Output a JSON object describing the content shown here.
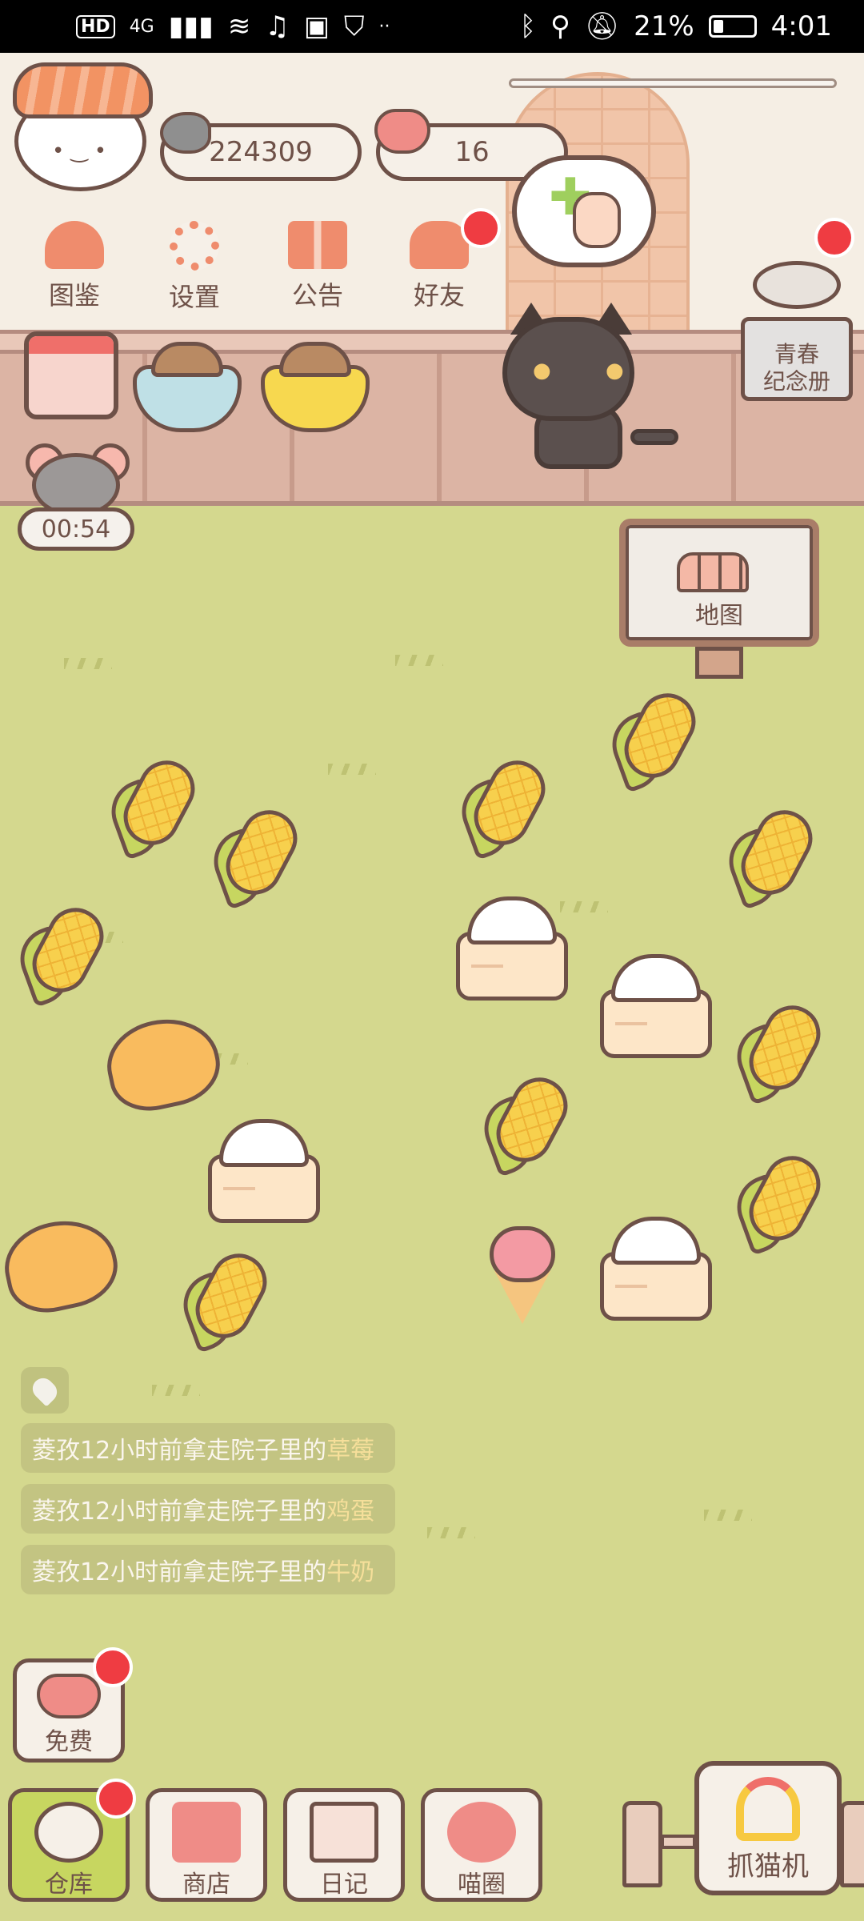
{
  "status_bar": {
    "network_badge": "HD",
    "network_type": "4G",
    "dots": "··",
    "battery": "21%",
    "time": "4:01"
  },
  "currency": {
    "fish": "224309",
    "hearts": "16"
  },
  "menu": {
    "book": "图鉴",
    "settings": "设置",
    "notice": "公告",
    "friends": "好友"
  },
  "yearbook": {
    "line1": "青春",
    "line2": "纪念册"
  },
  "timer": "00:54",
  "map_label": "地图",
  "log": [
    {
      "prefix": "菱孜12小时前拿走院子里的",
      "item": "草莓"
    },
    {
      "prefix": "菱孜12小时前拿走院子里的",
      "item": "鸡蛋"
    },
    {
      "prefix": "菱孜12小时前拿走院子里的",
      "item": "牛奶"
    }
  ],
  "free_label": "免费",
  "bottom_nav": {
    "warehouse": "仓库",
    "shop": "商店",
    "diary": "日记",
    "cat_circle": "喵圈",
    "claw_machine": "抓猫机"
  },
  "colors": {
    "grass": "#d4d88e",
    "outline": "#6e5148",
    "accent": "#ef8c6d",
    "notification": "#ef3c42",
    "active_tab": "#c7d660"
  },
  "icons": [
    "fish-icon",
    "heart-icon",
    "book-icon",
    "gear-icon",
    "gift-icon",
    "friends-icon",
    "calendar-icon",
    "hand-icon",
    "plus-icon",
    "map-gate-icon",
    "claw-icon"
  ]
}
